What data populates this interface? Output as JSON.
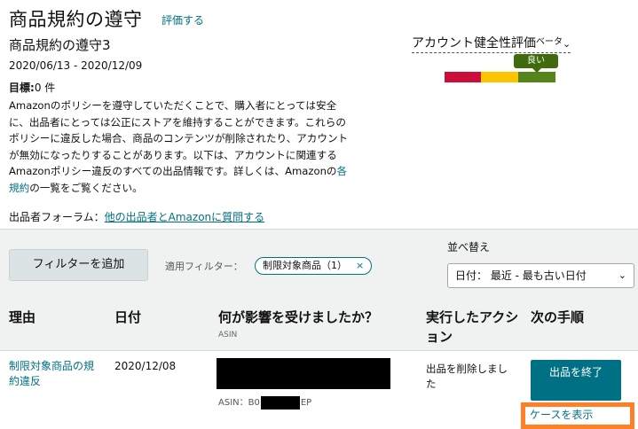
{
  "header": {
    "title": "商品規約の遵守",
    "rate_link": "評価する",
    "subtitle": "商品規約の遵守3",
    "date_range": "2020/06/13 - 2020/12/09",
    "goal_label": "目標:",
    "goal_value": "0 件",
    "desc_part1": "Amazonのポリシーを遵守していただくことで、購入者にとっては安全に、出品者にとっては公正にストアを維持することができます。これらのポリシーに違反した場合、商品のコンテンツが削除されたり、アカウントが無効になったりすることがあります。以下は、アカウントに関連するAmazonポリシー違反のすべての出品情報です。詳しくは、Amazonの",
    "desc_link": "各規約",
    "desc_part2": "の一覧をご覧ください。",
    "forum_label": "出品者フォーラム：",
    "forum_link": "他の出品者とAmazonに質問する"
  },
  "health": {
    "title": "アカウント健全性評価",
    "beta": "ベータ",
    "chevron": "⌄",
    "badge": "良い",
    "colors": {
      "bad": "#cc0c39",
      "fair": "#ffc400",
      "good": "#55841b"
    }
  },
  "filters": {
    "add_button": "フィルターを追加",
    "applied_label": "適用フィルター：",
    "chip_label": "制限対象商品（1）",
    "chip_close": "×",
    "sort_label": "並べ替え",
    "sort_value": "日付： 最近 - 最も古い日付",
    "sort_chevron": "⌄"
  },
  "table": {
    "columns": {
      "reason": "理由",
      "date": "日付",
      "affected": "何が影響を受けましたか？",
      "affected_sub": "ASIN",
      "action": "実行したアクション",
      "next": "次の手順"
    },
    "rows": [
      {
        "reason": "制限対象商品の規約違反",
        "date": "2020/12/08",
        "asin_prefix": "ASIN：B0",
        "asin_suffix": "EP",
        "action": "出品を削除しました",
        "next_button": "出品を終了",
        "case_link": "ケースを表示"
      }
    ]
  },
  "accent_color": "#007185",
  "highlight_color": "#ff7f27"
}
